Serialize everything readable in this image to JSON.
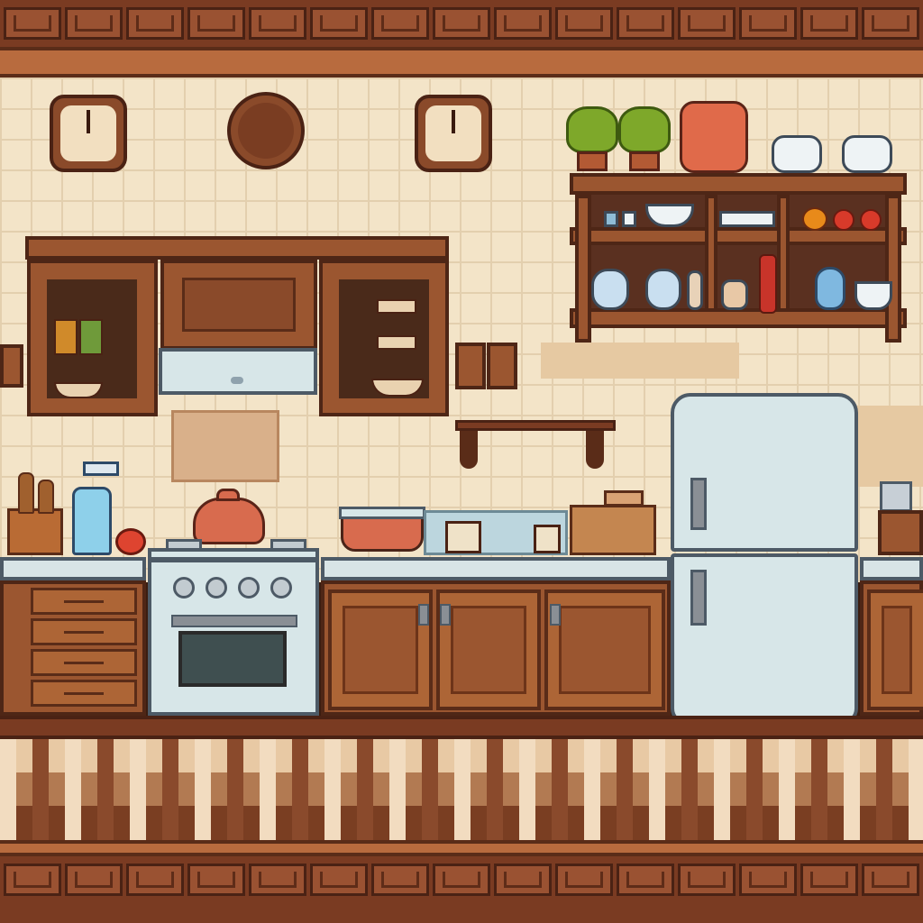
{
  "scene": {
    "title": "",
    "palette": {
      "wall": "#f3e4c8",
      "wood": "#9b5630",
      "wood_dark": "#4e2616",
      "steel": "#d7e6e8",
      "floor_light": "#f2dcc0",
      "floor_dark": "#8a4a2c"
    }
  },
  "objects": {
    "clocks": [
      {
        "name": "wall-clock-left",
        "icon": "clock-icon"
      },
      {
        "name": "wall-clock-center",
        "icon": "clock-icon"
      },
      {
        "name": "wall-clock-right",
        "icon": "clock-icon"
      }
    ],
    "upper_cabinets": [
      "cabinet-left-open",
      "cabinet-middle-closed",
      "cabinet-right-open"
    ],
    "shelf_items": [
      "potted-plant",
      "potted-plant",
      "tomato-pot",
      "bowl",
      "bowl",
      "cups",
      "plates",
      "fruit",
      "vase",
      "jug",
      "bottle",
      "teacup"
    ],
    "counter_items": [
      "utensil-holder",
      "spray-bottle",
      "apple",
      "kettle",
      "saucepan",
      "mug",
      "toaster",
      "canister"
    ],
    "appliances": [
      "stove-oven",
      "refrigerator",
      "range-hood"
    ]
  }
}
